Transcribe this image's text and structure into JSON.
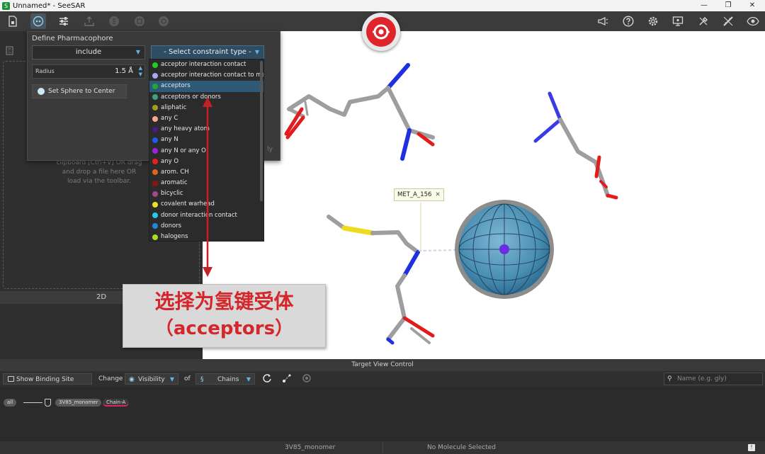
{
  "window": {
    "title": "Unnamed* - SeeSAR",
    "app_icon_letter": "S",
    "minimize_glyph": "—",
    "restore_glyph": "❐",
    "close_glyph": "✕"
  },
  "left_panel": {
    "drop_text_line1": "clipboard [Ctrl+V] OR drag",
    "drop_text_line2": "and drop a file here OR",
    "drop_text_line3": "load via the toolbar.",
    "view_label": "2D"
  },
  "pharmacophore": {
    "title": "Define Pharmacophore",
    "mode_value": "include",
    "constraint_placeholder": "- Select constraint type -",
    "radius_label": "Radius",
    "radius_value": "1.5 Å",
    "set_sphere_label": "Set Sphere to Center",
    "apply_partial": "ly"
  },
  "constraint_list": {
    "highlighted_index": 2,
    "items": [
      {
        "label": "acceptor interaction contact",
        "color": "#22cc22"
      },
      {
        "label": "acceptor interaction contact to metal",
        "color": "#a7a7f2"
      },
      {
        "label": "acceptors",
        "color": "#1fa83a"
      },
      {
        "label": "acceptors or donors",
        "color": "#3fa080"
      },
      {
        "label": "aliphatic",
        "color": "#a0a020"
      },
      {
        "label": "any C",
        "color": "#f5a98a"
      },
      {
        "label": "any heavy atom",
        "color": "#4b1a8a"
      },
      {
        "label": "any N",
        "color": "#1e5af0"
      },
      {
        "label": "any N or any O",
        "color": "#a020e0"
      },
      {
        "label": "any O",
        "color": "#ee1c1c"
      },
      {
        "label": "arom. CH",
        "color": "#e0641e"
      },
      {
        "label": "aromatic",
        "color": "#8c1414"
      },
      {
        "label": "bicyclic",
        "color": "#a04a8a"
      },
      {
        "label": "covalent warhead",
        "color": "#f0e020"
      },
      {
        "label": "donor interaction contact",
        "color": "#22ccee"
      },
      {
        "label": "donors",
        "color": "#1a8ae0"
      },
      {
        "label": "halogens",
        "color": "#a6e020"
      }
    ]
  },
  "annotation": {
    "line1": "选择为氢键受体",
    "line2": "（acceptors）"
  },
  "viewer": {
    "residue_label": "MET_A_156",
    "residue_close": "✕"
  },
  "target_view_control": {
    "title": "Target View Control",
    "show_binding_site_only": "Show Binding Site Only",
    "change_label": "Change",
    "visibility_label": "Visibility",
    "of_label": "of",
    "chains_label": "Chains",
    "search_placeholder": "Name (e.g. gly)",
    "tree_all": "all",
    "tree_monomer": "3V85_monomer",
    "tree_chain": "Chain-A"
  },
  "status": {
    "target_name": "3V85_monomer",
    "molecule_status": "No Molecule Selected"
  }
}
